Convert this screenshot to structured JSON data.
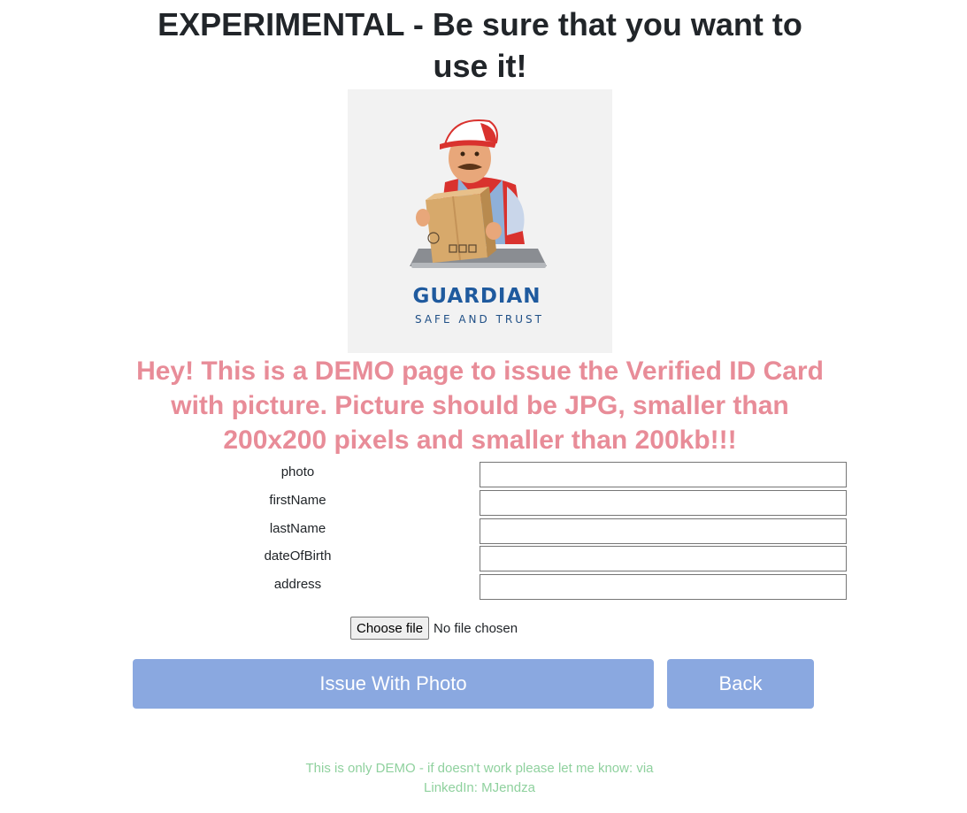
{
  "header": {
    "warning_title": "EXPERIMENTAL - Be sure that you want to use it!"
  },
  "logo": {
    "brand_name": "GUARDIAN",
    "tagline": "SAFE AND TRUST"
  },
  "notice": {
    "text": "Hey! This is a DEMO page to issue the Verified ID Card with picture. Picture should be JPG, smaller than 200x200 pixels and smaller than 200kb!!!"
  },
  "form": {
    "fields": [
      {
        "label": "photo",
        "value": ""
      },
      {
        "label": "firstName",
        "value": ""
      },
      {
        "label": "lastName",
        "value": ""
      },
      {
        "label": "dateOfBirth",
        "value": ""
      },
      {
        "label": "address",
        "value": ""
      }
    ],
    "file_button_label": "Choose file",
    "file_status": "No file chosen"
  },
  "actions": {
    "issue_label": "Issue With Photo",
    "back_label": "Back"
  },
  "footer": {
    "text": "This is only DEMO - if doesn't work please let me know: via LinkedIn: MJendza"
  },
  "colors": {
    "button_bg": "#8aa8e0",
    "notice_text": "#e88c98",
    "footer_text": "#8fd19e",
    "brand_blue": "#1f5a9e"
  }
}
